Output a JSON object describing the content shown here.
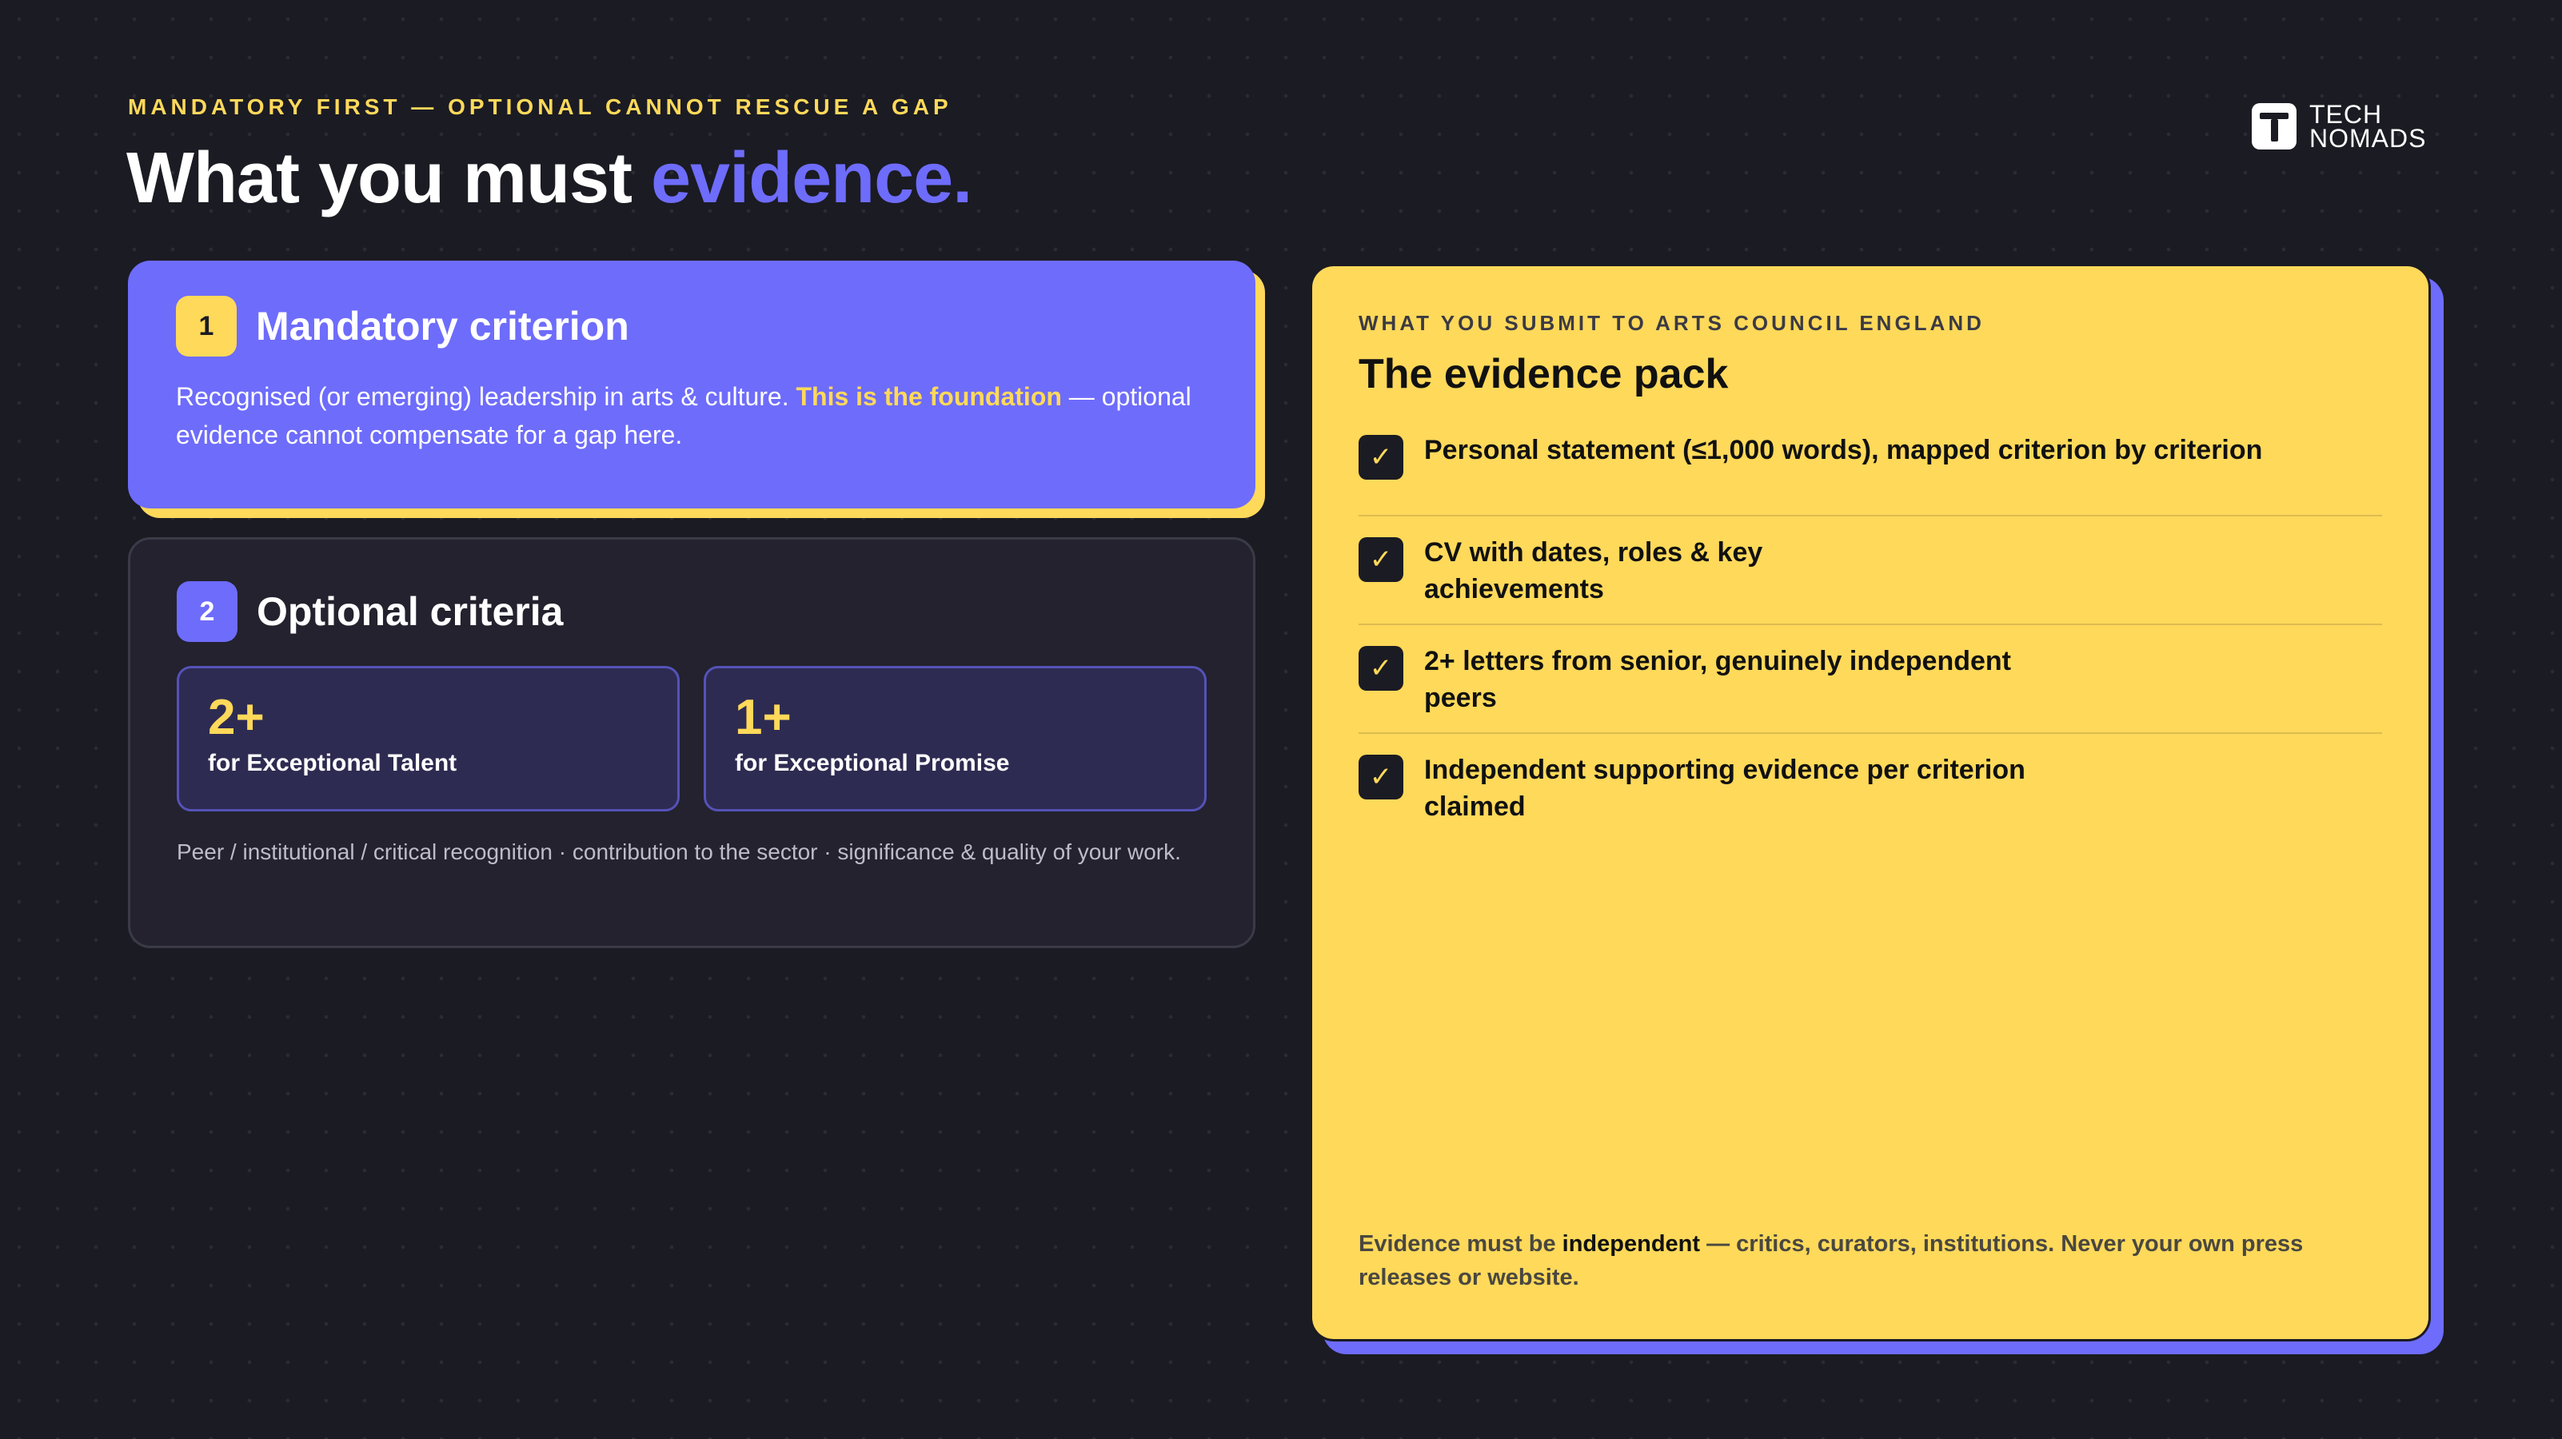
{
  "header": {
    "eyebrow": "MANDATORY FIRST — OPTIONAL CANNOT RESCUE A GAP",
    "title_main": "What you must ",
    "title_accent": "evidence."
  },
  "logo": {
    "line1": "TECH",
    "line2": "NOMADS",
    "icon": "tech-nomads-logo-icon"
  },
  "mandatory": {
    "number": "1",
    "title": "Mandatory criterion",
    "body_start": "Recognised (or emerging) leadership in arts & culture. ",
    "body_highlight": "This is the foundation",
    "body_end": " — optional evidence cannot compensate for a gap here."
  },
  "optional": {
    "number": "2",
    "title": "Optional criteria",
    "boxes": [
      {
        "value": "2+",
        "label": "for Exceptional Talent"
      },
      {
        "value": "1+",
        "label": "for Exceptional Promise"
      }
    ],
    "footer": "Peer / institutional / critical recognition · contribution to the sector · significance & quality of your work."
  },
  "evidence_pack": {
    "eyebrow": "WHAT YOU SUBMIT TO ARTS COUNCIL ENGLAND",
    "title": "The evidence pack",
    "check_glyph": "✓",
    "items": [
      "Personal statement (≤1,000 words), mapped criterion by criterion",
      "CV with dates, roles & key achievements",
      "2+ letters from senior, genuinely independent peers",
      "Independent supporting evidence per criterion claimed"
    ],
    "footer_start": "Evidence must be ",
    "footer_strong": "independent",
    "footer_end": " — critics, curators, institutions. Never your own press releases or website."
  },
  "colors": {
    "background": "#1b1b23",
    "accent_purple": "#6e6cfb",
    "accent_yellow": "#ffd95a"
  }
}
